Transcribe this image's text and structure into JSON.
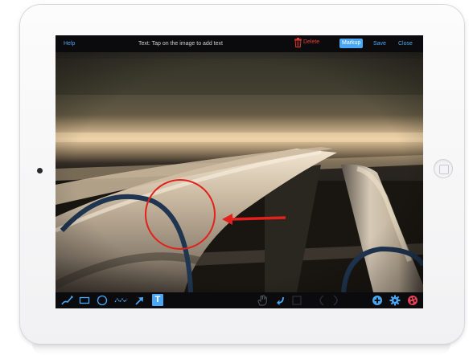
{
  "topbar": {
    "help_label": "Help",
    "instruction": "Text: Tap on the image to add text",
    "delete_label": "Delete",
    "markup_label": "Markup",
    "save_label": "Save",
    "close_label": "Close"
  },
  "toolbar": {
    "tools": [
      "pen-icon",
      "rectangle-icon",
      "circle-icon",
      "freehand-line-icon",
      "arrow-icon",
      "text-tool-icon"
    ],
    "active_tool": "text-tool-icon",
    "actions": [
      "hand-icon",
      "undo-icon",
      "crop-icon",
      "previous-icon",
      "next-icon",
      "add-icon",
      "gear-icon",
      "color-palette-icon"
    ],
    "text_tool_glyph": "T"
  },
  "colors": {
    "accent": "#49a7f5",
    "delete": "#e83a32",
    "annotation": "#e3201b",
    "bar_background": "#0b0b0d"
  }
}
